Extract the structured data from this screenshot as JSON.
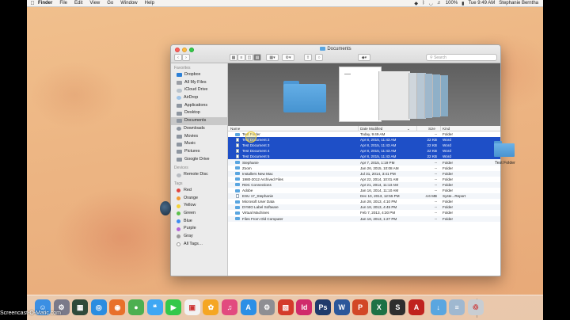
{
  "menubar": {
    "app_name": "Finder",
    "menus": [
      "File",
      "Edit",
      "View",
      "Go",
      "Window",
      "Help"
    ],
    "battery": "100%",
    "datetime": "Tue 9:49 AM",
    "user": "Stephanie Berntha"
  },
  "window": {
    "title": "Documents",
    "search_placeholder": "Search"
  },
  "sidebar": {
    "favorites_heading": "Favorites",
    "favorites": [
      "Dropbox",
      "All My Files",
      "iCloud Drive",
      "AirDrop",
      "Applications",
      "Desktop",
      "Documents",
      "Downloads",
      "Movies",
      "Music",
      "Pictures",
      "Google Drive"
    ],
    "selected": "Documents",
    "devices_heading": "Devices",
    "devices": [
      "Remote Disc"
    ],
    "tags_heading": "Tags",
    "tags": [
      {
        "label": "Red",
        "color": "#e0443e"
      },
      {
        "label": "Orange",
        "color": "#f29b32"
      },
      {
        "label": "Yellow",
        "color": "#f2d33a"
      },
      {
        "label": "Green",
        "color": "#5bc04b"
      },
      {
        "label": "Blue",
        "color": "#3d8cf0"
      },
      {
        "label": "Purple",
        "color": "#b466d6"
      },
      {
        "label": "Gray",
        "color": "#9a9a9a"
      },
      {
        "label": "All Tags…",
        "color": ""
      }
    ]
  },
  "coverflow": {
    "caption": "Test Document 2"
  },
  "columns": {
    "name": "Name",
    "date": "Date Modified",
    "size": "Size",
    "kind": "Kind"
  },
  "rows": [
    {
      "name": "Test Folder",
      "date": "Today, 9:49 AM",
      "size": "--",
      "kind": "Folder",
      "type": "folder",
      "selected": false
    },
    {
      "name": "Test Document 2",
      "date": "Apr 8, 2015, 11:43 AM",
      "size": "22 KB",
      "kind": "Word",
      "type": "doc",
      "selected": true
    },
    {
      "name": "Test Document 3",
      "date": "Apr 8, 2015, 11:43 AM",
      "size": "22 KB",
      "kind": "Word",
      "type": "doc",
      "selected": true
    },
    {
      "name": "Test Document 4",
      "date": "Apr 8, 2015, 11:43 AM",
      "size": "22 KB",
      "kind": "Word",
      "type": "doc",
      "selected": true
    },
    {
      "name": "Test Document 5",
      "date": "Apr 8, 2015, 11:43 AM",
      "size": "22 KB",
      "kind": "Word",
      "type": "doc",
      "selected": true
    },
    {
      "name": "Stephanie",
      "date": "Apr 7, 2015, 1:19 PM",
      "size": "--",
      "kind": "Folder",
      "type": "folder",
      "selected": false
    },
    {
      "name": "Zoom",
      "date": "Jan 26, 2015, 10:08 AM",
      "size": "--",
      "kind": "Folder",
      "type": "folder",
      "selected": false
    },
    {
      "name": "Installers New Mac",
      "date": "Jul 31, 2014, 3:41 PM",
      "size": "--",
      "kind": "Folder",
      "type": "folder",
      "selected": false
    },
    {
      "name": "1980-2012 Archived Files",
      "date": "Apr 22, 2014, 10:01 AM",
      "size": "--",
      "kind": "Folder",
      "type": "folder",
      "selected": false
    },
    {
      "name": "RDC Connections",
      "date": "Apr 21, 2014, 11:13 AM",
      "size": "--",
      "kind": "Folder",
      "type": "folder",
      "selected": false
    },
    {
      "name": "Adobe",
      "date": "Jan 16, 2014, 11:10 AM",
      "size": "--",
      "kind": "Folder",
      "type": "folder",
      "selected": false
    },
    {
      "name": "ESU 17_Stephanie",
      "date": "Dec 10, 2013, 12:55 PM",
      "size": "4.6 MB",
      "kind": "Syste...Report",
      "type": "doc",
      "selected": false
    },
    {
      "name": "Microsoft User Data",
      "date": "Jun 28, 2013, 4:10 PM",
      "size": "--",
      "kind": "Folder",
      "type": "folder",
      "selected": false
    },
    {
      "name": "DYMO Label Software",
      "date": "Jun 18, 2013, 4:45 PM",
      "size": "--",
      "kind": "Folder",
      "type": "folder",
      "selected": false
    },
    {
      "name": "Virtual Machines",
      "date": "Feb 7, 2013, 4:30 PM",
      "size": "--",
      "kind": "Folder",
      "type": "folder",
      "selected": false
    },
    {
      "name": "Files From Old Computer",
      "date": "Jan 16, 2013, 1:27 PM",
      "size": "--",
      "kind": "Folder",
      "type": "folder",
      "selected": false
    }
  ],
  "desktop": {
    "folder_label": "Test Folder"
  },
  "dock": {
    "apps": [
      {
        "name": "finder",
        "color": "#3b8fe3",
        "glyph": "☺"
      },
      {
        "name": "launchpad",
        "color": "#7a7a8a",
        "glyph": "⚙"
      },
      {
        "name": "mission-control",
        "color": "#2f4a3a",
        "glyph": "▦"
      },
      {
        "name": "safari",
        "color": "#2a8de0",
        "glyph": "◎"
      },
      {
        "name": "firefox",
        "color": "#e8702a",
        "glyph": "◉"
      },
      {
        "name": "chrome",
        "color": "#4caf50",
        "glyph": "●"
      },
      {
        "name": "messages",
        "color": "#3fa7f3",
        "glyph": "❝"
      },
      {
        "name": "facetime",
        "color": "#34c84a",
        "glyph": "▶"
      },
      {
        "name": "calendar",
        "color": "#f2f2f2",
        "glyph": "▣"
      },
      {
        "name": "photos",
        "color": "#f5a623",
        "glyph": "✿"
      },
      {
        "name": "itunes",
        "color": "#e24a7f",
        "glyph": "♫"
      },
      {
        "name": "app-store",
        "color": "#2c8fe6",
        "glyph": "A"
      },
      {
        "name": "system-preferences",
        "color": "#8e8e93",
        "glyph": "⚙"
      },
      {
        "name": "snagit",
        "color": "#d43a2b",
        "glyph": "▧"
      },
      {
        "name": "indesign",
        "color": "#d02a6b",
        "glyph": "Id"
      },
      {
        "name": "photoshop",
        "color": "#1f3a6b",
        "glyph": "Ps"
      },
      {
        "name": "word",
        "color": "#2b579a",
        "glyph": "W"
      },
      {
        "name": "powerpoint",
        "color": "#d24726",
        "glyph": "P"
      },
      {
        "name": "excel",
        "color": "#1e7145",
        "glyph": "X"
      },
      {
        "name": "sdm",
        "color": "#2e2e2e",
        "glyph": "S"
      },
      {
        "name": "acrobat",
        "color": "#c0221e",
        "glyph": "A"
      },
      {
        "name": "downloads-stack",
        "color": "#5aa6e0",
        "glyph": "↓"
      },
      {
        "name": "documents-stack",
        "color": "#9fb8d0",
        "glyph": "≡"
      },
      {
        "name": "trash",
        "color": "#c8cdd2",
        "glyph": "♲"
      }
    ]
  },
  "watermark": "Screencast-O-Matic.com"
}
